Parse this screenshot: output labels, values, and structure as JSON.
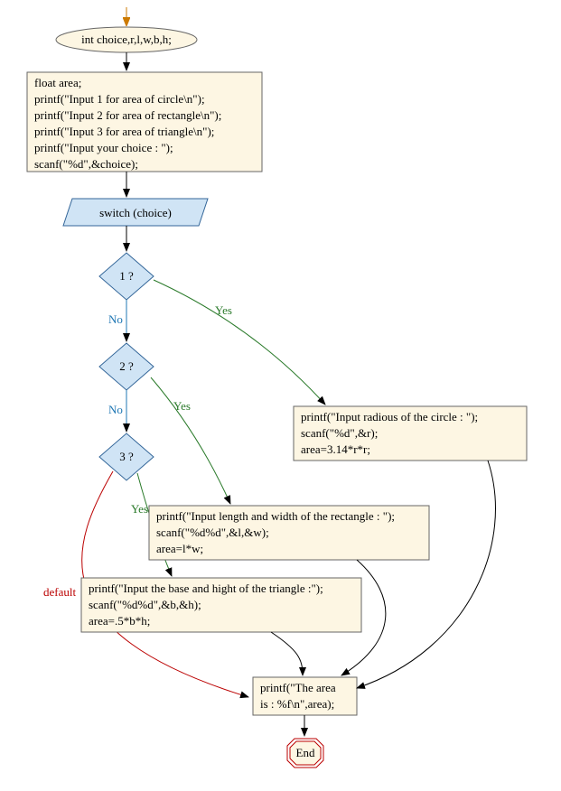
{
  "nodes": {
    "start_decl": "int choice,r,l,w,b,h;",
    "init_block": [
      "float area;",
      "printf(\"Input 1 for area of circle\\n\");",
      "printf(\"Input 2 for area of rectangle\\n\");",
      "printf(\"Input 3 for area of triangle\\n\");",
      "printf(\"Input your choice : \");",
      "scanf(\"%d\",&choice);"
    ],
    "switch": "switch (choice)",
    "case1": "1 ?",
    "case2": "2 ?",
    "case3": "3 ?",
    "circle_block": [
      "printf(\"Input radious of the circle : \");",
      "scanf(\"%d\",&r);",
      "area=3.14*r*r;"
    ],
    "rect_block": [
      "printf(\"Input length and width of the rectangle : \");",
      "scanf(\"%d%d\",&l,&w);",
      "area=l*w;"
    ],
    "tri_block": [
      "printf(\"Input the base and hight of the triangle :\");",
      "scanf(\"%d%d\",&b,&h);",
      "area=.5*b*h;"
    ],
    "output_block": [
      "printf(\"The area",
      "is : %f\\n\",area);"
    ],
    "end": "End"
  },
  "edges": {
    "no": "No",
    "yes": "Yes",
    "default": "default"
  }
}
